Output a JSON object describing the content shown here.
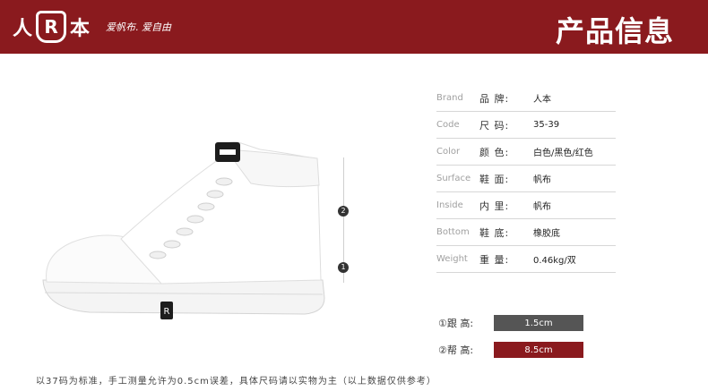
{
  "header": {
    "logo_left": "人",
    "logo_mark": "R",
    "logo_right": "本",
    "slogan": "爱帆布. 爱自由",
    "title": "产品信息",
    "bg_color": "#8a1a1e"
  },
  "specs": [
    {
      "en": "Brand",
      "zh": "品  牌:",
      "value": "人本"
    },
    {
      "en": "Code",
      "zh": "尺  码:",
      "value": "35-39"
    },
    {
      "en": "Color",
      "zh": "颜  色:",
      "value": "白色/黑色/红色"
    },
    {
      "en": "Surface",
      "zh": "鞋  面:",
      "value": "帆布"
    },
    {
      "en": "Inside",
      "zh": "内  里:",
      "value": "帆布"
    },
    {
      "en": "Bottom",
      "zh": "鞋  底:",
      "value": "橡胶底"
    },
    {
      "en": "Weight",
      "zh": "重  量:",
      "value": "0.46kg/双"
    }
  ],
  "markers": {
    "one": "1",
    "two": "2"
  },
  "heights": [
    {
      "label": "①跟  高:",
      "value": "1.5cm",
      "color": "#555555"
    },
    {
      "label": "②帮  高:",
      "value": "8.5cm",
      "color": "#8a1a1e"
    }
  ],
  "footer": {
    "note": "以37码为标准，手工测量允许为0.5cm误差，具体尺码请以实物为主（以上数据仅供参考）"
  }
}
